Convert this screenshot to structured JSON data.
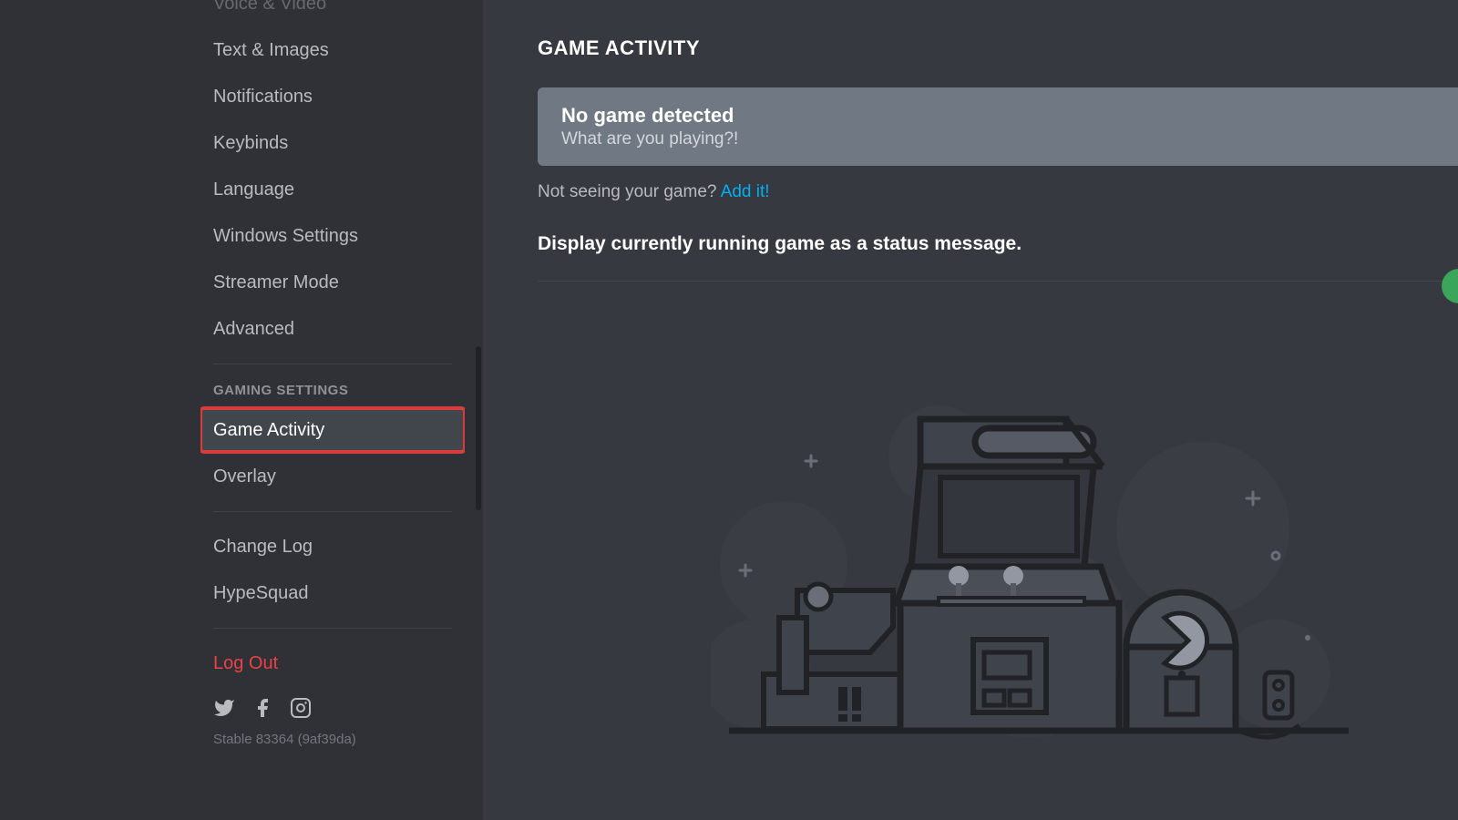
{
  "sidebar": {
    "items": [
      {
        "label": "Voice & Video"
      },
      {
        "label": "Text & Images"
      },
      {
        "label": "Notifications"
      },
      {
        "label": "Keybinds"
      },
      {
        "label": "Language"
      },
      {
        "label": "Windows Settings"
      },
      {
        "label": "Streamer Mode"
      },
      {
        "label": "Advanced"
      }
    ],
    "gaming_header": "GAMING SETTINGS",
    "gaming_items": [
      {
        "label": "Game Activity"
      },
      {
        "label": "Overlay"
      }
    ],
    "misc_items": [
      {
        "label": "Change Log"
      },
      {
        "label": "HypeSquad"
      }
    ],
    "logout_label": "Log Out",
    "version_text": "Stable 83364 (9af39da)"
  },
  "content": {
    "title": "GAME ACTIVITY",
    "notice_heading": "No game detected",
    "notice_sub": "What are you playing?!",
    "not_seeing": "Not seeing your game? ",
    "add_link": "Add it!",
    "display_label": "Display currently running game as a status message."
  }
}
